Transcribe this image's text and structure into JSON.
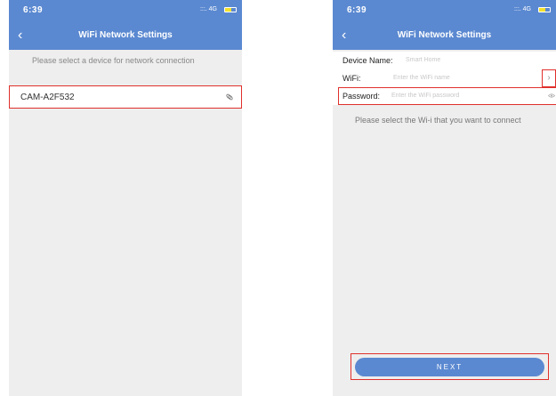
{
  "left_screen": {
    "status": {
      "time": "6:39",
      "signal": ":::. 4G"
    },
    "nav": {
      "title": "WiFi Network Settings"
    },
    "hint": "Please select a device for network connection",
    "device": {
      "name": "CAM-A2F532"
    }
  },
  "right_screen": {
    "status": {
      "time": "6:39",
      "signal": ":::. 4G"
    },
    "nav": {
      "title": "WiFi Network Settings"
    },
    "device_name": {
      "label": "Device Name:",
      "placeholder": "Smart Home"
    },
    "wifi": {
      "label": "WiFi:",
      "placeholder": "Enter the WiFi name"
    },
    "password": {
      "label": "Password:",
      "placeholder": "Enter the WiFi password"
    },
    "hint": "Please select the Wi-i that you want to connect",
    "next_label": "NEXT"
  },
  "colors": {
    "header": "#5b89d1",
    "highlight": "#e0302c",
    "background": "#eeeeee"
  },
  "battery_level": 0.6
}
